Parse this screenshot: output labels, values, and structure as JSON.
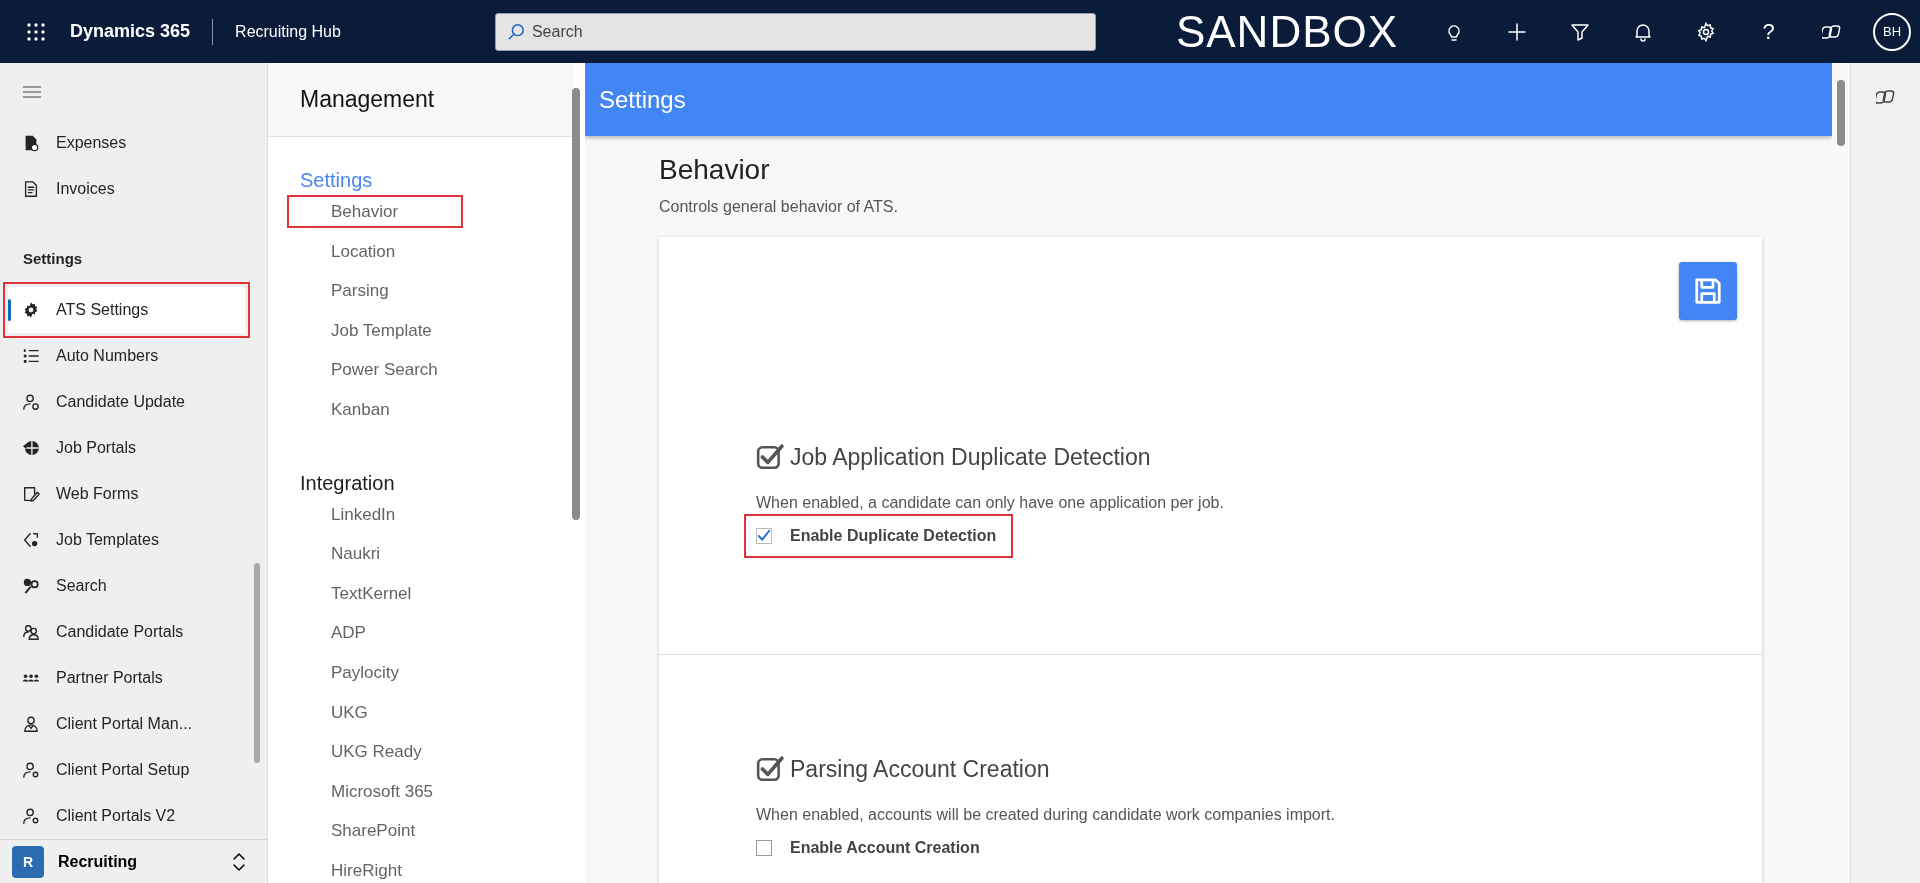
{
  "top_bar": {
    "app_name": "Dynamics 365",
    "area_name": "Recruiting Hub",
    "search": {
      "placeholder": "Search"
    },
    "environment": "SANDBOX",
    "help": "?",
    "avatar": "BH"
  },
  "sidebar": {
    "groups": [
      {
        "items": [
          {
            "label": "Expenses",
            "selected": false,
            "highlighted": false
          },
          {
            "label": "Invoices",
            "selected": false,
            "highlighted": false
          }
        ]
      },
      {
        "title": "Settings",
        "items": [
          {
            "label": "ATS Settings",
            "selected": true,
            "highlighted": true
          },
          {
            "label": "Auto Numbers",
            "selected": false,
            "highlighted": false
          },
          {
            "label": "Candidate Update",
            "selected": false,
            "highlighted": false
          },
          {
            "label": "Job Portals",
            "selected": false,
            "highlighted": false
          },
          {
            "label": "Web Forms",
            "selected": false,
            "highlighted": false
          },
          {
            "label": "Job Templates",
            "selected": false,
            "highlighted": false
          },
          {
            "label": "Search",
            "selected": false,
            "highlighted": false
          },
          {
            "label": "Candidate Portals",
            "selected": false,
            "highlighted": false
          },
          {
            "label": "Partner Portals",
            "selected": false,
            "highlighted": false
          },
          {
            "label": "Client Portal Man...",
            "selected": false,
            "highlighted": false
          },
          {
            "label": "Client Portal Setup",
            "selected": false,
            "highlighted": false
          },
          {
            "label": "Client Portals V2",
            "selected": false,
            "highlighted": false
          }
        ]
      }
    ],
    "area_switcher": {
      "badge": "R",
      "label": "Recruiting"
    }
  },
  "management_nav": {
    "title": "Management",
    "sections": [
      {
        "title": "Settings",
        "active": true,
        "items": [
          {
            "label": "Behavior",
            "highlighted": true
          },
          {
            "label": "Location",
            "highlighted": false
          },
          {
            "label": "Parsing",
            "highlighted": false
          },
          {
            "label": "Job Template",
            "highlighted": false
          },
          {
            "label": "Power Search",
            "highlighted": false
          },
          {
            "label": "Kanban",
            "highlighted": false
          }
        ]
      },
      {
        "title": "Integration",
        "active": false,
        "items": [
          {
            "label": "LinkedIn",
            "highlighted": false
          },
          {
            "label": "Naukri",
            "highlighted": false
          },
          {
            "label": "TextKernel",
            "highlighted": false
          },
          {
            "label": "ADP",
            "highlighted": false
          },
          {
            "label": "Paylocity",
            "highlighted": false
          },
          {
            "label": "UKG",
            "highlighted": false
          },
          {
            "label": "UKG Ready",
            "highlighted": false
          },
          {
            "label": "Microsoft 365",
            "highlighted": false
          },
          {
            "label": "SharePoint",
            "highlighted": false
          },
          {
            "label": "HireRight",
            "highlighted": false
          }
        ]
      }
    ]
  },
  "page_header": {
    "title": "Settings"
  },
  "content": {
    "title": "Behavior",
    "description": "Controls general behavior of ATS.",
    "sections": [
      {
        "title": "Job Application Duplicate Detection",
        "description": "When enabled, a candidate can only have one application per job.",
        "option": {
          "label": "Enable Duplicate Detection",
          "checked": true,
          "highlighted": true
        }
      },
      {
        "title": "Parsing Account Creation",
        "description": "When enabled, accounts will be created during candidate work companies import.",
        "option": {
          "label": "Enable Account Creation",
          "checked": false,
          "highlighted": false
        }
      }
    ]
  }
}
